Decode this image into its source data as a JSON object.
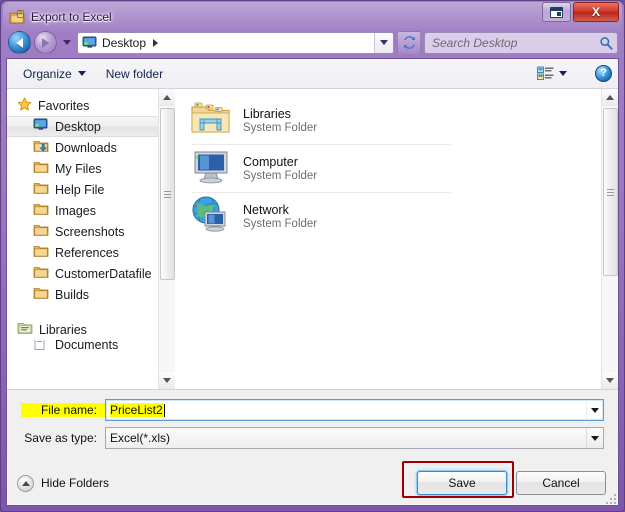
{
  "window": {
    "title": "Export to Excel",
    "title_icon": "excel-export-folder-icon",
    "restore_label": "Restore",
    "close_label": "X"
  },
  "nav": {
    "back_label": "Back",
    "forward_label": "Forward",
    "history_label": "Recent pages",
    "address": {
      "icon": "desktop-icon",
      "crumb": "Desktop",
      "dropdown_label": "Previous locations"
    },
    "refresh_label": "Refresh",
    "search": {
      "placeholder": "Search Desktop",
      "icon": "search-icon"
    }
  },
  "toolbar": {
    "organize_label": "Organize",
    "new_folder_label": "New folder",
    "view_icon": "view-mode-icon",
    "help_icon": "?",
    "help_label": "Help"
  },
  "sidebar": {
    "items": [
      {
        "label": "Favorites",
        "icon": "star-icon",
        "level": "group",
        "selected": false
      },
      {
        "label": "Desktop",
        "icon": "desktop-icon",
        "level": "child",
        "selected": true
      },
      {
        "label": "Downloads",
        "icon": "downloads-folder-icon",
        "level": "child",
        "selected": false
      },
      {
        "label": "My Files",
        "icon": "folder-icon",
        "level": "child",
        "selected": false
      },
      {
        "label": "Help File",
        "icon": "folder-icon",
        "level": "child",
        "selected": false
      },
      {
        "label": "Images",
        "icon": "folder-icon",
        "level": "child",
        "selected": false
      },
      {
        "label": "Screenshots",
        "icon": "folder-icon",
        "level": "child",
        "selected": false
      },
      {
        "label": "References",
        "icon": "folder-icon",
        "level": "child",
        "selected": false
      },
      {
        "label": "CustomerDatafile",
        "icon": "folder-icon",
        "level": "child",
        "selected": false
      },
      {
        "label": "Builds",
        "icon": "folder-icon",
        "level": "child",
        "selected": false
      },
      {
        "label": "Libraries",
        "icon": "libraries-icon",
        "level": "group",
        "selected": false
      },
      {
        "label": "Documents",
        "icon": "documents-library-icon",
        "level": "child",
        "selected": false
      }
    ]
  },
  "filelist": {
    "items": [
      {
        "name": "Libraries",
        "type": "System Folder",
        "icon": "libraries-folder-icon"
      },
      {
        "name": "Computer",
        "type": "System Folder",
        "icon": "computer-icon"
      },
      {
        "name": "Network",
        "type": "System Folder",
        "icon": "network-globe-icon"
      }
    ]
  },
  "form": {
    "filename_label": "File name:",
    "filename_value": "PriceList2",
    "filename_dropdown": "Open file name history",
    "savetype_label": "Save as type:",
    "savetype_value": "Excel(*.xls)",
    "savetype_dropdown": "Open save type list"
  },
  "footer": {
    "hide_folders_label": "Hide Folders",
    "hide_folders_icon": "chevron-up-icon",
    "save_label": "Save",
    "cancel_label": "Cancel"
  },
  "colors": {
    "frame": "#8c63b6",
    "highlight": "#ffff00",
    "annotation": "#9e0000",
    "focus": "#3c8bc6",
    "close": "#d2392c"
  }
}
